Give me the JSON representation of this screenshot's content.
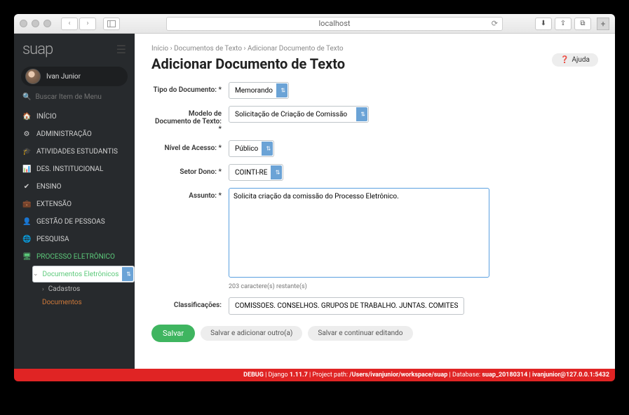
{
  "browser": {
    "url": "localhost"
  },
  "brand": "suap",
  "user": {
    "name": "Ivan Junior"
  },
  "search": {
    "placeholder": "Buscar Item de Menu"
  },
  "nav": [
    {
      "icon": "home",
      "label": "INÍCIO"
    },
    {
      "icon": "cog",
      "label": "ADMINISTRAÇÃO"
    },
    {
      "icon": "grad",
      "label": "ATIVIDADES ESTUDANTIS"
    },
    {
      "icon": "chart",
      "label": "DES. INSTITUCIONAL"
    },
    {
      "icon": "check",
      "label": "ENSINO"
    },
    {
      "icon": "case",
      "label": "EXTENSÃO"
    },
    {
      "icon": "user",
      "label": "GESTÃO DE PESSOAS"
    },
    {
      "icon": "globe",
      "label": "PESQUISA"
    },
    {
      "icon": "screen",
      "label": "PROCESSO ELETRÔNICO",
      "active": true
    }
  ],
  "subnav": {
    "docs": "Documentos Eletrônicos",
    "cad": "Cadastros",
    "doclink": "Documentos"
  },
  "crumb": [
    "Início",
    "Documentos de Texto",
    "Adicionar Documento de Texto"
  ],
  "title": "Adicionar Documento de Texto",
  "help": "Ajuda",
  "form": {
    "tipo": {
      "label": "Tipo do Documento: *",
      "value": "Memorando"
    },
    "modelo": {
      "label": "Modelo de Documento de Texto: *",
      "value": "Solicitação de Criação de Comissão"
    },
    "nivel": {
      "label": "Nível de Acesso: *",
      "value": "Público"
    },
    "setor": {
      "label": "Setor Dono: *",
      "value": "COINTI-RE"
    },
    "assunto": {
      "label": "Assunto: *",
      "value": "Solicita criação da comissão do Processo Eletrônico.",
      "hint": "203 caractere(s) restante(s)"
    },
    "classif": {
      "label": "Classificações:",
      "value": "COMISSÕES. CONSELHOS. GRUPOS DE TRABALHO. JUNTAS. COMITÊS. AT"
    }
  },
  "actions": {
    "save": "Salvar",
    "saveadd": "Salvar e adicionar outro(a)",
    "savecont": "Salvar e continuar editando"
  },
  "debug": {
    "pre": "DEBUG",
    "django": " | Django ",
    "djver": "1.11.7",
    "path_lbl": " | Project path: ",
    "path": "/Users/ivanjunior/workspace/suap",
    "db_lbl": " | Database: ",
    "db": "suap_20180314 | ivanjunior@127.0.0.1:5432"
  }
}
